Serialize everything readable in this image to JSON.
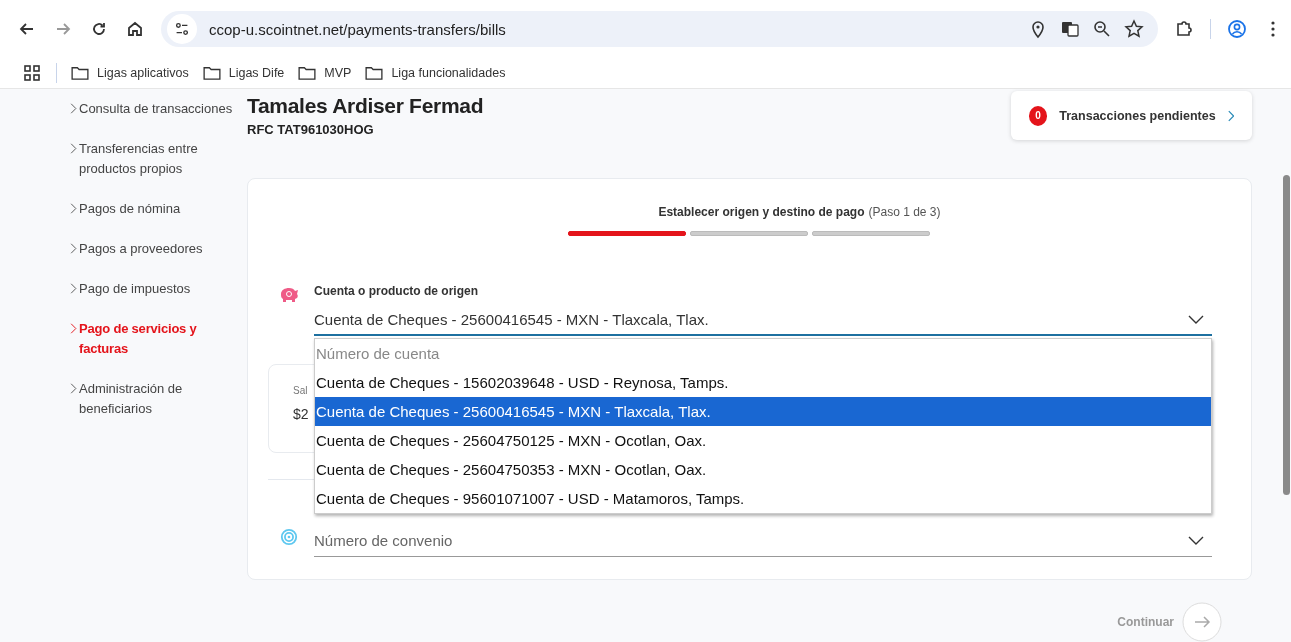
{
  "browser": {
    "url": "ccop-u.scointnet.net/payments-transfers/bills",
    "bookmarks": [
      {
        "label": "Ligas aplicativos"
      },
      {
        "label": "Ligas Dife"
      },
      {
        "label": "MVP"
      },
      {
        "label": "Liga funcionalidades"
      }
    ]
  },
  "sidebar": {
    "items": [
      {
        "label": "Consulta de transacciones",
        "selected": false
      },
      {
        "label": "Transferencias entre productos propios",
        "selected": false
      },
      {
        "label": "Pagos de nómina",
        "selected": false
      },
      {
        "label": "Pagos a proveedores",
        "selected": false
      },
      {
        "label": "Pago de impuestos",
        "selected": false
      },
      {
        "label": "Pago de servicios y facturas",
        "selected": true
      },
      {
        "label": "Administración de beneficiarios",
        "selected": false
      }
    ]
  },
  "header": {
    "name": "Tamales Ardiser Fermad",
    "rfc": "RFC TAT961030HOG"
  },
  "pending": {
    "count": "0",
    "label": "Transacciones pendientes"
  },
  "wizard": {
    "step_title": "Establecer origen y destino de pago",
    "step_counter": "(Paso 1 de 3)",
    "steps": [
      {
        "active": true
      },
      {
        "active": false
      },
      {
        "active": false
      }
    ]
  },
  "origin": {
    "label": "Cuenta o producto de origen",
    "value": "Cuenta de Cheques - 25600416545 - MXN - Tlaxcala, Tlax.",
    "dropdown": {
      "placeholder": "Número de cuenta",
      "options": [
        {
          "label": "Cuenta de Cheques - 15602039648 - USD - Reynosa, Tamps.",
          "selected": false
        },
        {
          "label": "Cuenta de Cheques - 25600416545 - MXN - Tlaxcala, Tlax.",
          "selected": true
        },
        {
          "label": "Cuenta de Cheques - 25604750125 - MXN - Ocotlan, Oax.",
          "selected": false
        },
        {
          "label": "Cuenta de Cheques - 25604750353 - MXN - Ocotlan, Oax.",
          "selected": false
        },
        {
          "label": "Cuenta de Cheques - 95601071007 - USD - Matamoros, Tamps.",
          "selected": false
        }
      ]
    }
  },
  "balance": {
    "label": "Sal",
    "amount": "$2"
  },
  "destination": {
    "placeholder": "Número de convenio"
  },
  "continue": {
    "label": "Continuar",
    "disabled": true
  }
}
